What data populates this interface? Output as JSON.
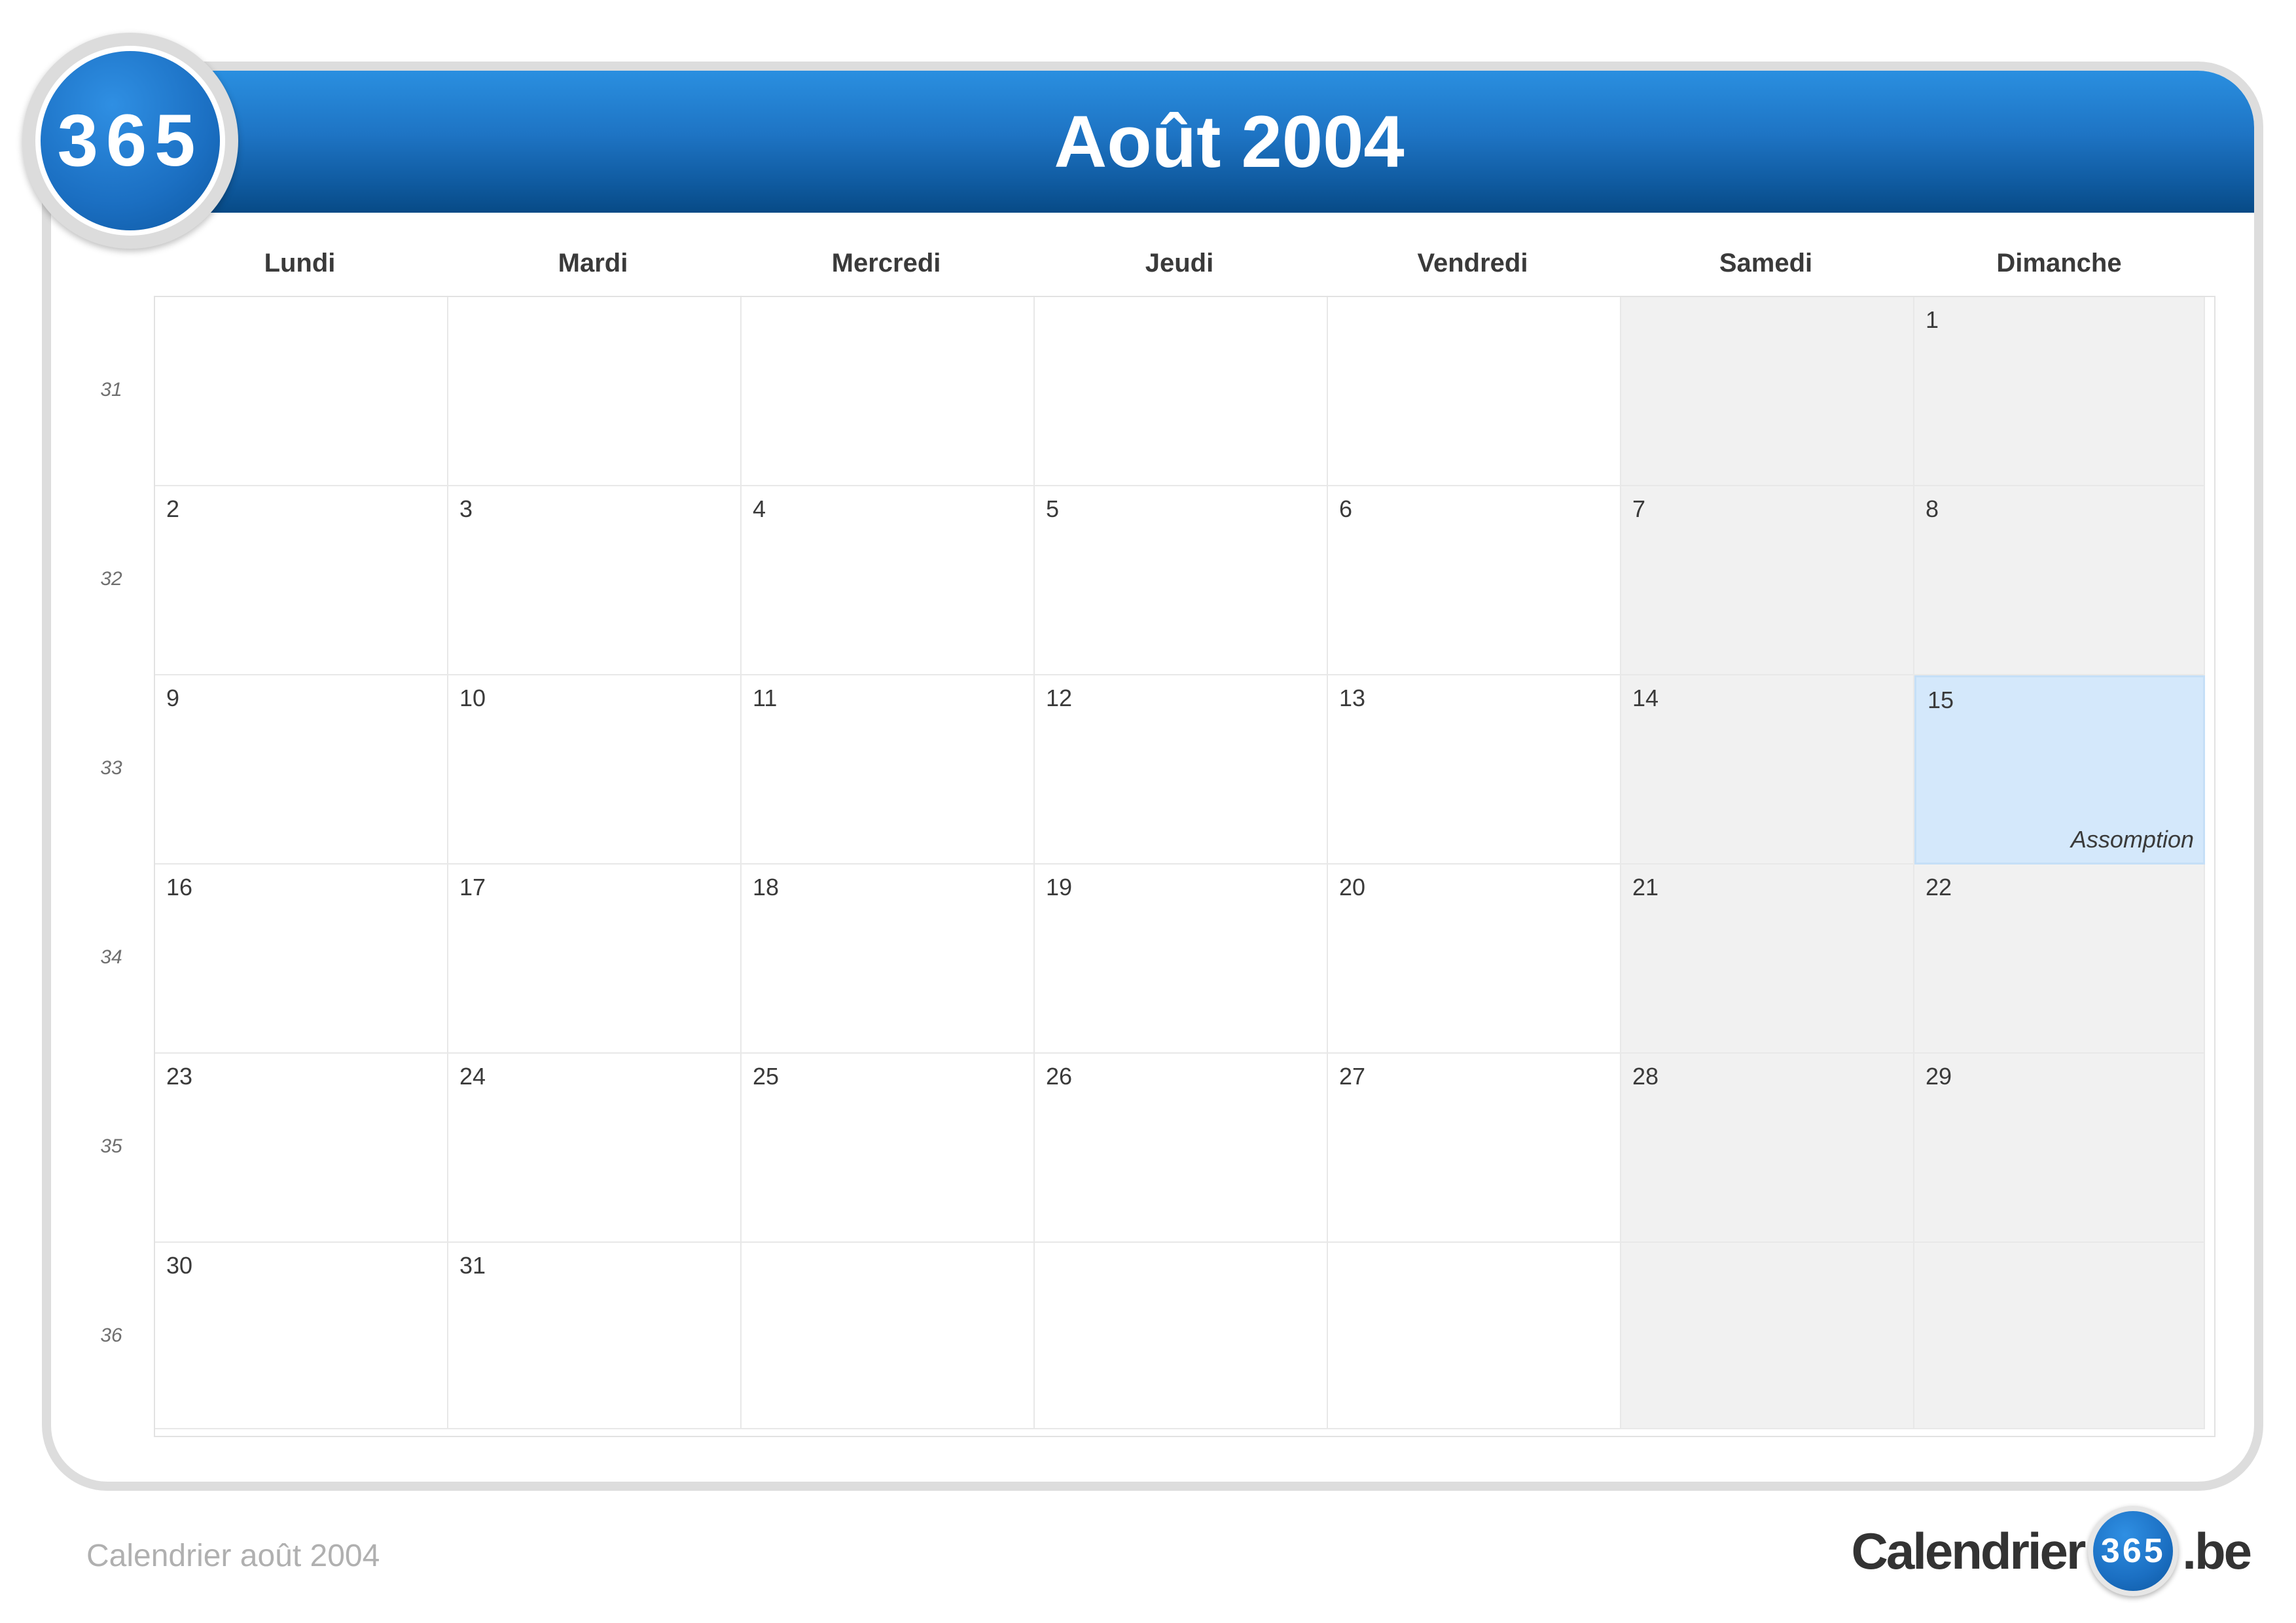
{
  "header": {
    "title": "Août 2004"
  },
  "badge": {
    "text": "365"
  },
  "weekdays": [
    "Lundi",
    "Mardi",
    "Mercredi",
    "Jeudi",
    "Vendredi",
    "Samedi",
    "Dimanche"
  ],
  "week_numbers": [
    "31",
    "32",
    "33",
    "34",
    "35",
    "36"
  ],
  "weeks": [
    [
      "",
      "",
      "",
      "",
      "",
      "",
      "1"
    ],
    [
      "2",
      "3",
      "4",
      "5",
      "6",
      "7",
      "8"
    ],
    [
      "9",
      "10",
      "11",
      "12",
      "13",
      "14",
      "15"
    ],
    [
      "16",
      "17",
      "18",
      "19",
      "20",
      "21",
      "22"
    ],
    [
      "23",
      "24",
      "25",
      "26",
      "27",
      "28",
      "29"
    ],
    [
      "30",
      "31",
      "",
      "",
      "",
      "",
      ""
    ]
  ],
  "holiday": {
    "day": "15",
    "label": "Assomption"
  },
  "footer": {
    "caption": "Calendrier août 2004"
  },
  "brand": {
    "prefix": "Calendrier",
    "badge": "365",
    "suffix": ".be"
  },
  "colors": {
    "header_blue": "#1e74c4",
    "holiday_fill": "#d4e8fb",
    "weekend_fill": "#ececec"
  }
}
